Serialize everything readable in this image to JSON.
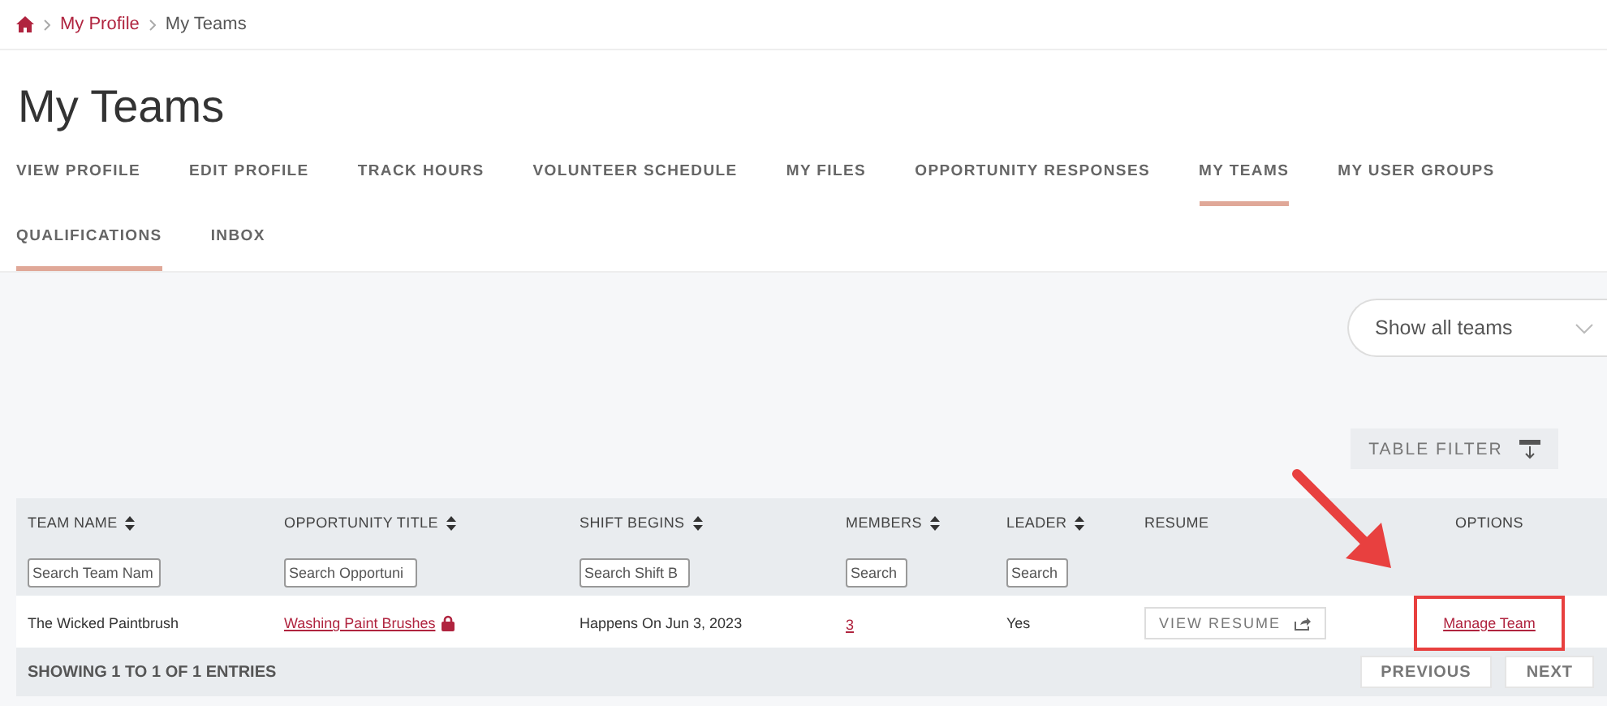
{
  "breadcrumb": [
    {
      "label": "My Profile",
      "link": true
    },
    {
      "label": "My Teams",
      "link": false
    }
  ],
  "title": "My Teams",
  "tabs": [
    {
      "label": "VIEW PROFILE",
      "selected": false
    },
    {
      "label": "EDIT PROFILE",
      "selected": false
    },
    {
      "label": "TRACK HOURS",
      "selected": false
    },
    {
      "label": "VOLUNTEER SCHEDULE",
      "selected": false
    },
    {
      "label": "MY FILES",
      "selected": false
    },
    {
      "label": "OPPORTUNITY RESPONSES",
      "selected": false
    },
    {
      "label": "MY TEAMS",
      "selected": true
    },
    {
      "label": "MY USER GROUPS",
      "selected": false
    },
    {
      "label": "QUALIFICATIONS",
      "selected": true
    },
    {
      "label": "INBOX",
      "selected": false
    }
  ],
  "team_filter": {
    "value": "Show all teams"
  },
  "table_filter_button": "TABLE FILTER",
  "table": {
    "columns": [
      {
        "label": "TEAM NAME",
        "sortable": true,
        "placeholder": "Search Team Nam"
      },
      {
        "label": "OPPORTUNITY TITLE",
        "sortable": true,
        "placeholder": "Search Opportuni"
      },
      {
        "label": "SHIFT BEGINS",
        "sortable": true,
        "placeholder": "Search Shift B"
      },
      {
        "label": "MEMBERS",
        "sortable": true,
        "placeholder": "Search"
      },
      {
        "label": "LEADER",
        "sortable": true,
        "placeholder": "Search"
      },
      {
        "label": "RESUME",
        "sortable": false
      },
      {
        "label": "OPTIONS",
        "sortable": false
      }
    ],
    "rows": [
      {
        "team_name": "The Wicked Paintbrush",
        "opportunity_title": "Washing Paint Brushes",
        "locked": true,
        "shift_begins": "Happens On Jun 3, 2023",
        "members": "3",
        "leader": "Yes",
        "resume_button": "VIEW RESUME",
        "option_link": "Manage Team",
        "highlighted": true
      }
    ],
    "summary": "SHOWING 1 TO 1 OF 1 ENTRIES",
    "pager": [
      "PREVIOUS",
      "NEXT"
    ]
  },
  "annotation_arrow": true
}
